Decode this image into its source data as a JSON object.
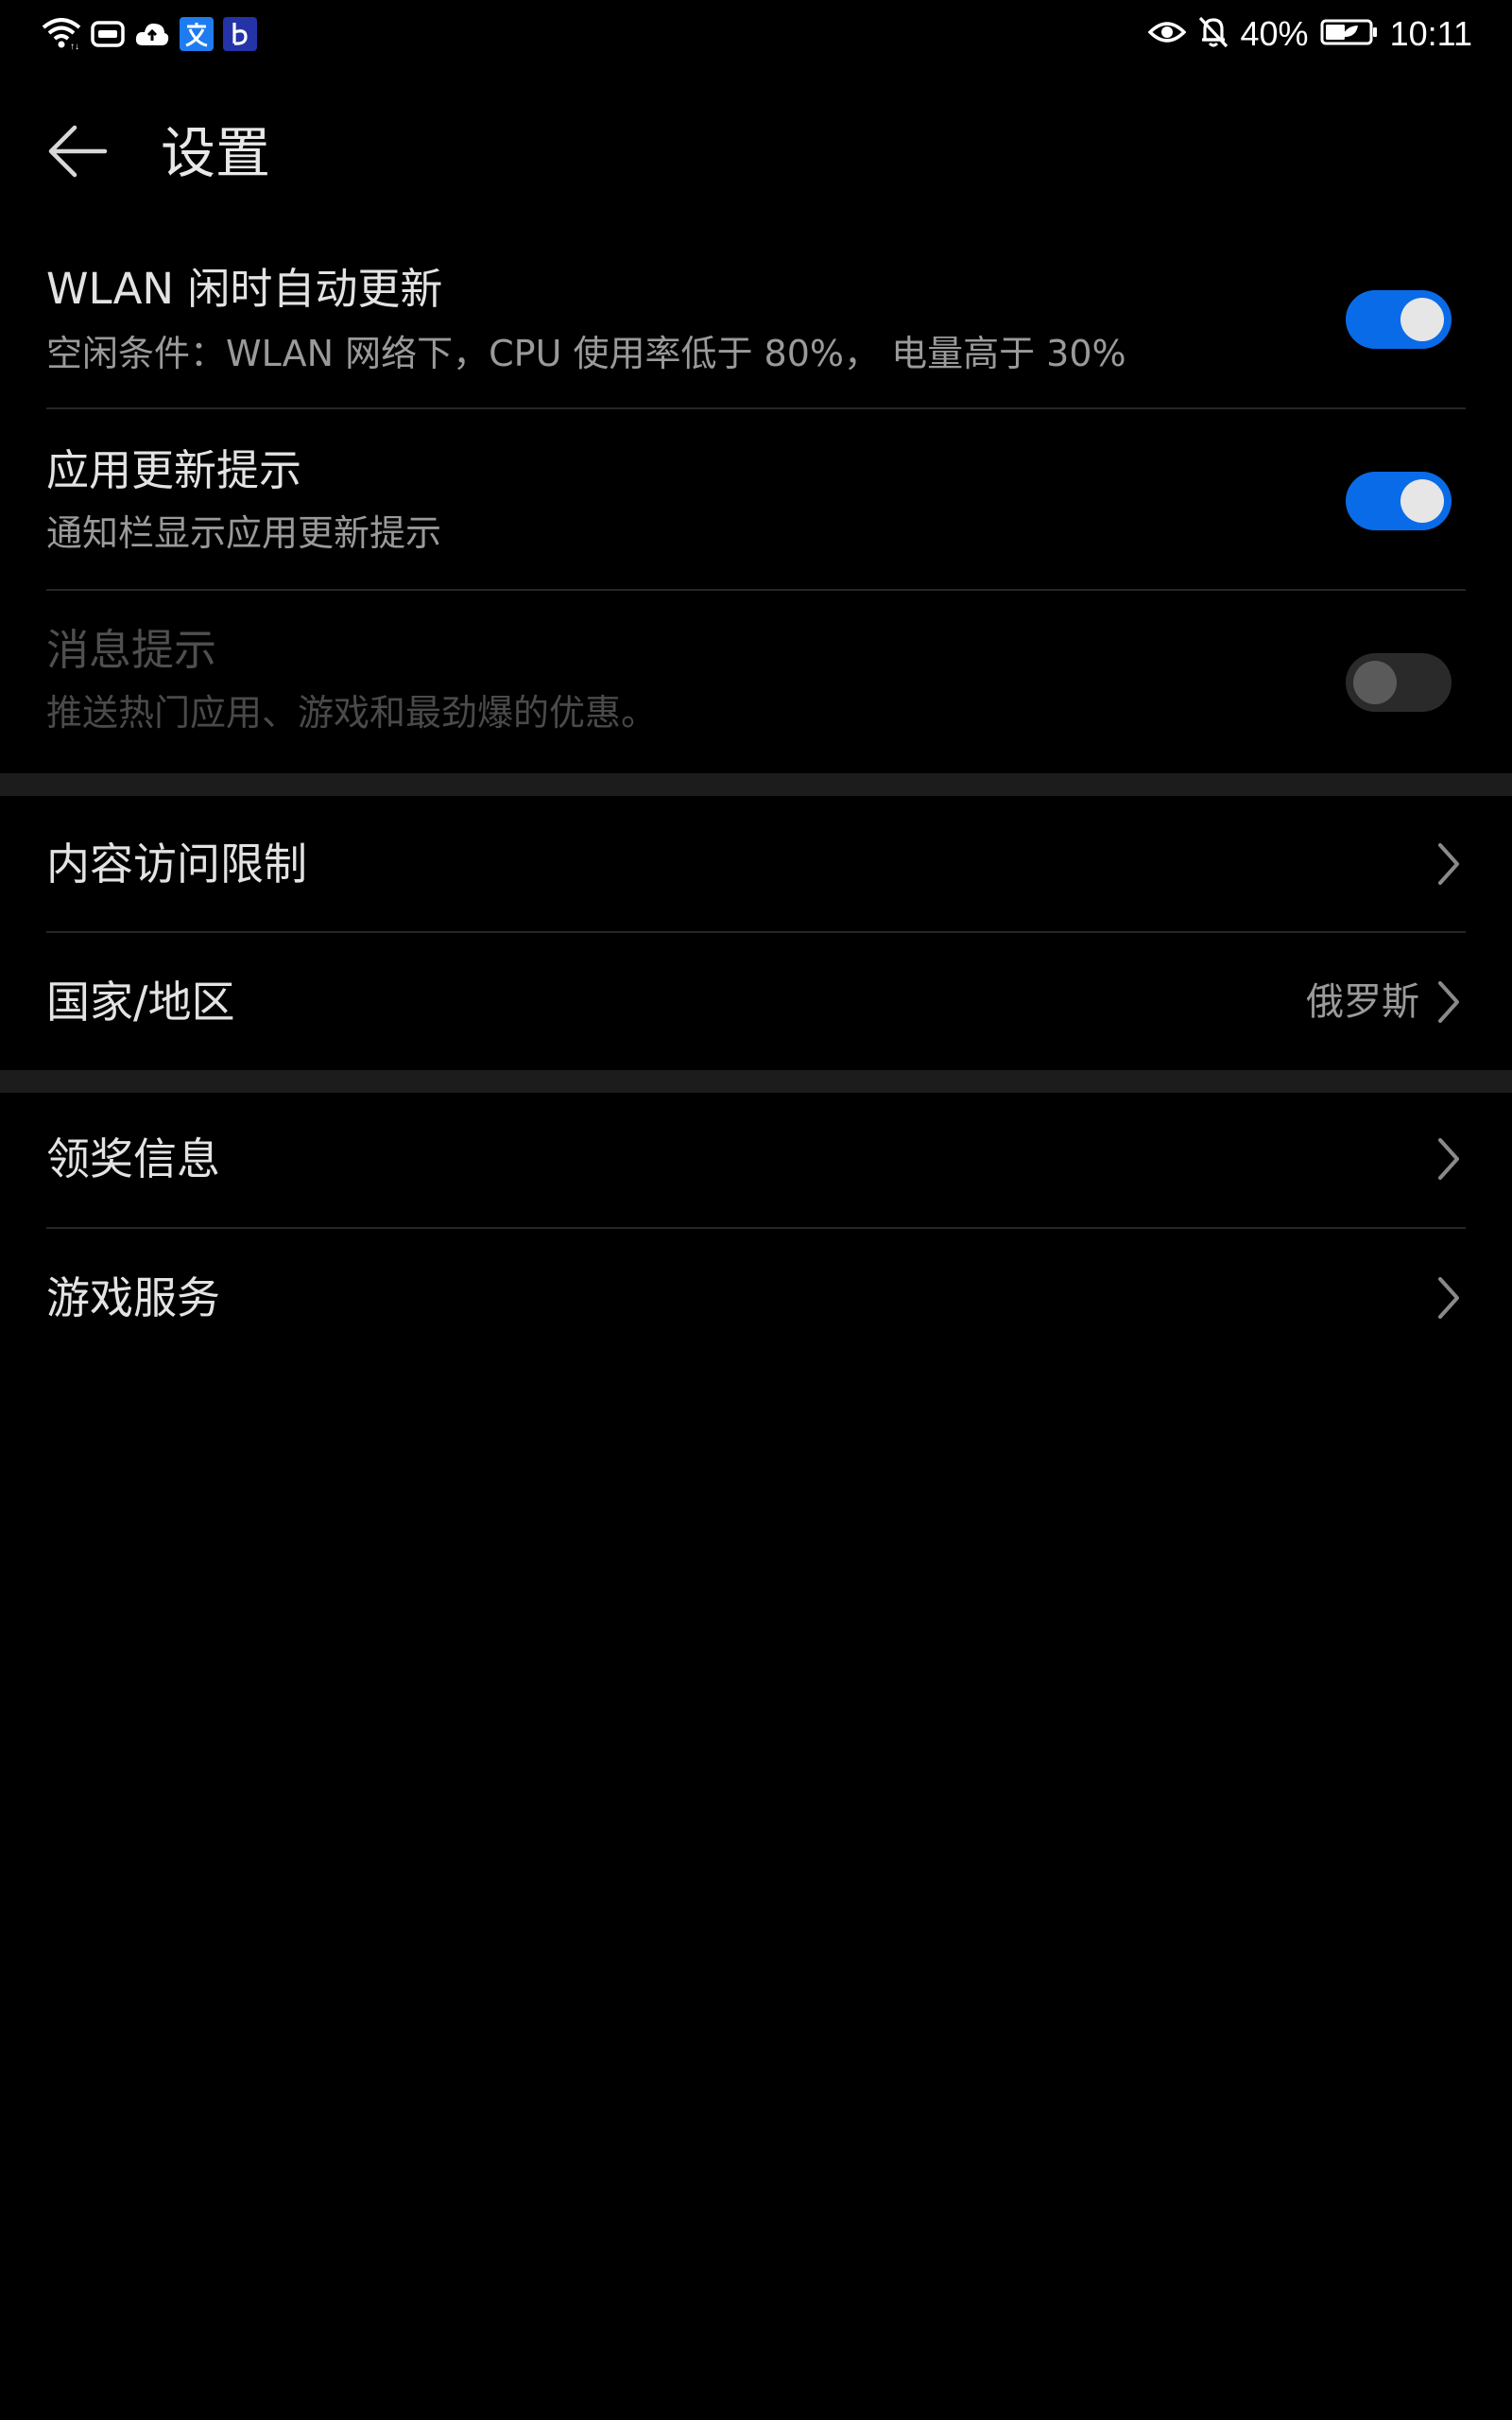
{
  "status_bar": {
    "left_icons": [
      "wifi-icon",
      "card-icon",
      "cloud-upload-icon",
      "translate-app-icon",
      "b-app-icon"
    ],
    "battery_percent": "40%",
    "time": "10:11",
    "right_icons": [
      "eye-icon",
      "bell-off-icon",
      "battery-icon"
    ]
  },
  "header": {
    "back_icon": "arrow-left-icon",
    "title": "设置"
  },
  "toggle_settings": [
    {
      "title": "WLAN 闲时自动更新",
      "subtitle": "空闲条件：WLAN 网络下，CPU 使用率低于 80%， 电量高于 30%",
      "enabled": true,
      "available": true
    },
    {
      "title": "应用更新提示",
      "subtitle": "通知栏显示应用更新提示",
      "enabled": true,
      "available": true
    },
    {
      "title": "消息提示",
      "subtitle": "推送热门应用、游戏和最劲爆的优惠。",
      "enabled": false,
      "available": false
    }
  ],
  "section2": {
    "items": [
      {
        "title": "内容访问限制",
        "value": ""
      },
      {
        "title": "国家/地区",
        "value": "俄罗斯"
      }
    ]
  },
  "section3": {
    "items": [
      {
        "title": "领奖信息"
      },
      {
        "title": "游戏服务"
      }
    ]
  },
  "colors": {
    "background": "#000000",
    "accent": "#0a6be8",
    "text_primary": "#e3e3e3",
    "text_secondary": "#9a9a9a"
  }
}
